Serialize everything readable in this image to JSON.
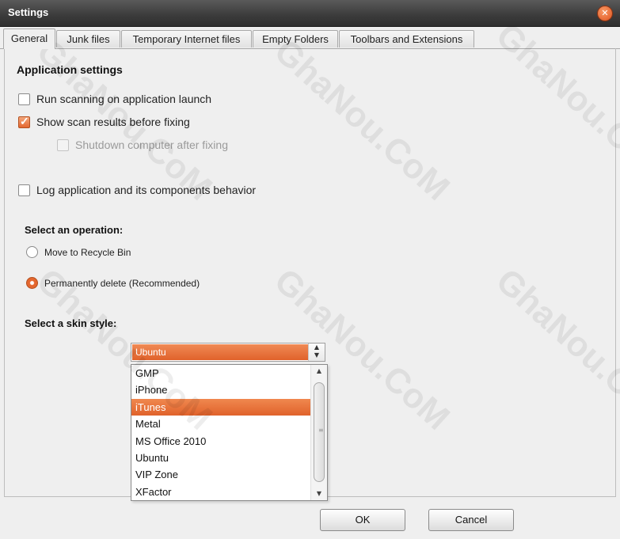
{
  "window": {
    "title": "Settings",
    "close_icon": "close-icon"
  },
  "tabs": [
    {
      "label": "General",
      "active": true
    },
    {
      "label": "Junk files"
    },
    {
      "label": "Temporary Internet files"
    },
    {
      "label": "Empty Folders"
    },
    {
      "label": "Toolbars and Extensions"
    }
  ],
  "application_settings": {
    "title": "Application settings",
    "run_scanning": {
      "label": "Run scanning on application launch",
      "checked": false
    },
    "show_results": {
      "label": "Show scan results before fixing",
      "checked": true
    },
    "shutdown": {
      "label": "Shutdown computer after fixing",
      "checked": false,
      "disabled": true
    },
    "log_behavior": {
      "label": "Log application and its components behavior",
      "checked": false
    }
  },
  "operation": {
    "title": "Select an operation:",
    "options": [
      {
        "label": "Move to Recycle Bin",
        "selected": false
      },
      {
        "label": "Permanently delete (Recommended)",
        "selected": true
      }
    ]
  },
  "skin": {
    "title": "Select a skin style:",
    "current": "Ubuntu",
    "options": [
      "GMP",
      "iPhone",
      "iTunes",
      "Metal",
      "MS Office 2010",
      "Ubuntu",
      "VIP Zone",
      "XFactor"
    ],
    "highlighted": "iTunes"
  },
  "footer": {
    "ok_label": "OK",
    "cancel_label": "Cancel"
  },
  "watermark": "GhaNou.CoM",
  "colors": {
    "accent": "#e4672f",
    "titlebar": "#3b3b3b"
  }
}
